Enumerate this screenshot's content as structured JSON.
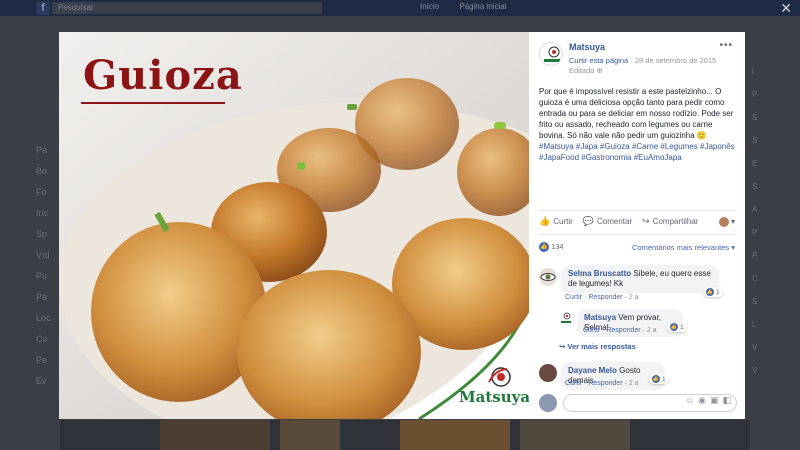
{
  "background": {
    "search_placeholder": "Pesquisar",
    "nav": [
      "Início",
      "Página inicial"
    ],
    "left_items": [
      "Pá",
      "Bo",
      "Fo",
      "Inc",
      "Sp",
      "Víd",
      "Pu",
      "Pá",
      "Loc",
      "Co",
      "Pe",
      "Ev"
    ],
    "right_items": [
      "l",
      "P",
      "S",
      "S",
      "E",
      "S",
      "A",
      "P",
      "P",
      "C",
      "S",
      "L",
      "V",
      "V"
    ]
  },
  "photo": {
    "title": "Guioza",
    "logo_text": "Matsuya"
  },
  "post": {
    "page_name": "Matsuya",
    "follow_link": "Curtir esta página",
    "date": "28 de setembro de 2015",
    "edited": "Editado",
    "text": "Por que é impossível resistir a este pastelzinho... O guioza é uma deliciosa opção tanto para pedir como entrada ou para se deliciar em nosso rodízio. Pode ser frito ou assado, recheado com legumes ou carne bovina. Só não vale não pedir um guiozinha 🙂",
    "hashtags": "#Matsuya #Japa #Guioza #Carne #Legumes #Japonês #JapaFood #Gastronomia #EuAmoJapa",
    "actions": {
      "like": "Curtir",
      "comment": "Comentar",
      "share": "Compartilhar"
    },
    "like_count": "134",
    "sort_label": "Comentários mais relevantes ▾"
  },
  "comments": [
    {
      "name": "Selma Bruscatto",
      "text": "Sibele, eu quero esse de legumes! Kk",
      "like": "Curtir",
      "reply": "Responder",
      "time": "2 a",
      "reactions": "1"
    },
    {
      "name": "Matsuya",
      "text": "Vem provar, Selma!",
      "like": "Curtir",
      "reply": "Responder",
      "time": "2 a",
      "reactions": "1"
    },
    {
      "name": "Dayane Melo",
      "text": "Gosto demais",
      "like": "Curtir",
      "reply": "Responder",
      "time": "2 a",
      "reactions": "1"
    }
  ],
  "more_replies": "Ver mais respostas",
  "composer": {
    "placeholder": ""
  },
  "colors": {
    "brand_red": "#8c1414",
    "link_blue": "#365899",
    "logo_green": "#1e7a3a"
  }
}
